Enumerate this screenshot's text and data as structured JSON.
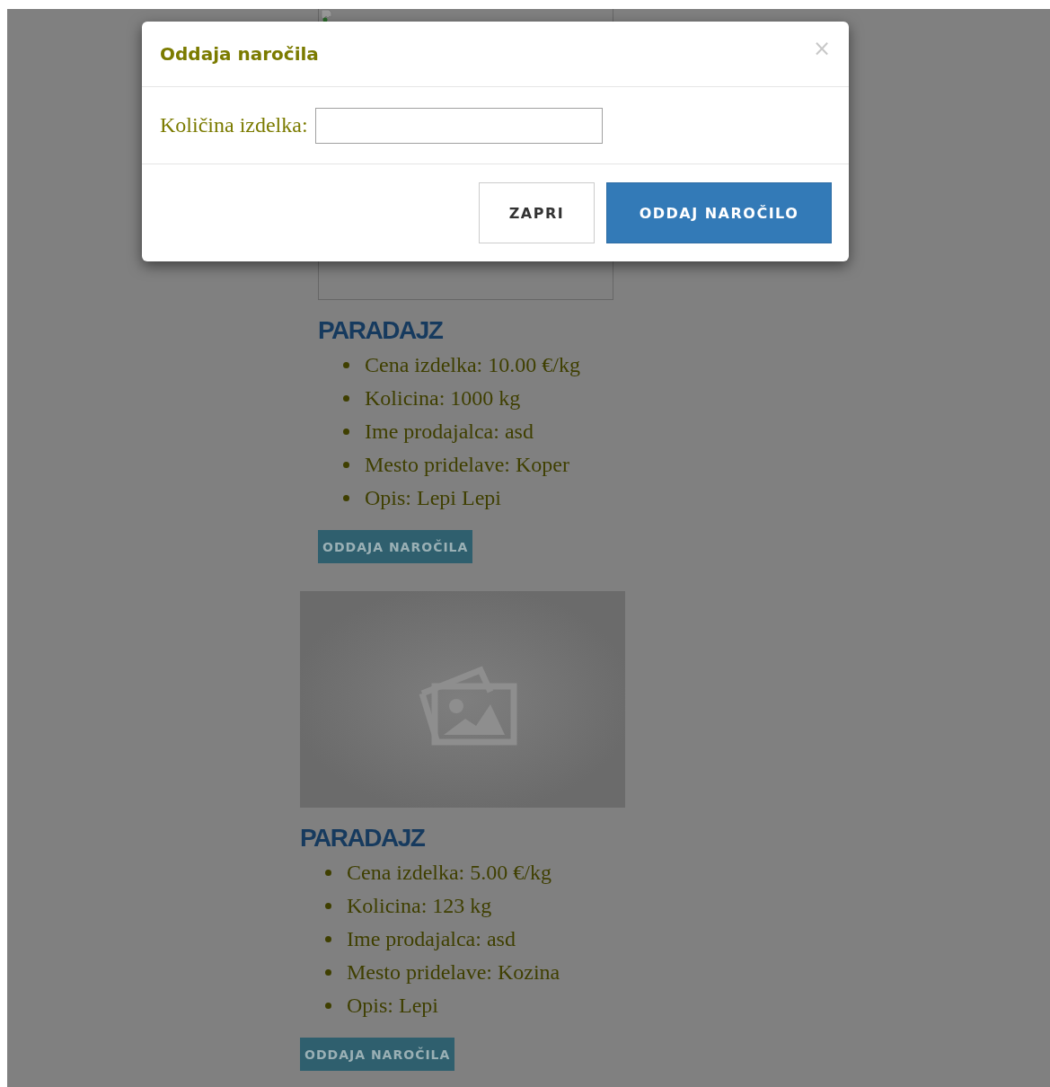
{
  "dialog": {
    "title": "Oddaja naročila",
    "close": "×",
    "field_label": "Količina izdelka:",
    "buttons": [
      {
        "label": "ZAPRI",
        "kind": "secondary"
      },
      {
        "label": "ODDAJ NAROČILO",
        "kind": "primary"
      }
    ]
  },
  "products": [
    {
      "kind": "broken",
      "name": "PARADAJZ",
      "details": [
        "Cena izdelka: 10.00 €/kg",
        "Kolicina: 1000 kg",
        "Ime prodajalca: asd",
        "Mesto pridelave: Koper",
        "Opis: Lepi Lepi"
      ],
      "button": "ODDAJA NAROČILA"
    },
    {
      "kind": "placeholder",
      "name": "PARADAJZ",
      "details": [
        "Cena izdelka: 5.00 €/kg",
        "Kolicina: 123 kg",
        "Ime prodajalca: asd",
        "Mesto pridelave: Kozina",
        "Opis: Lepi"
      ],
      "button": "ODDAJA NAROČILA"
    }
  ]
}
